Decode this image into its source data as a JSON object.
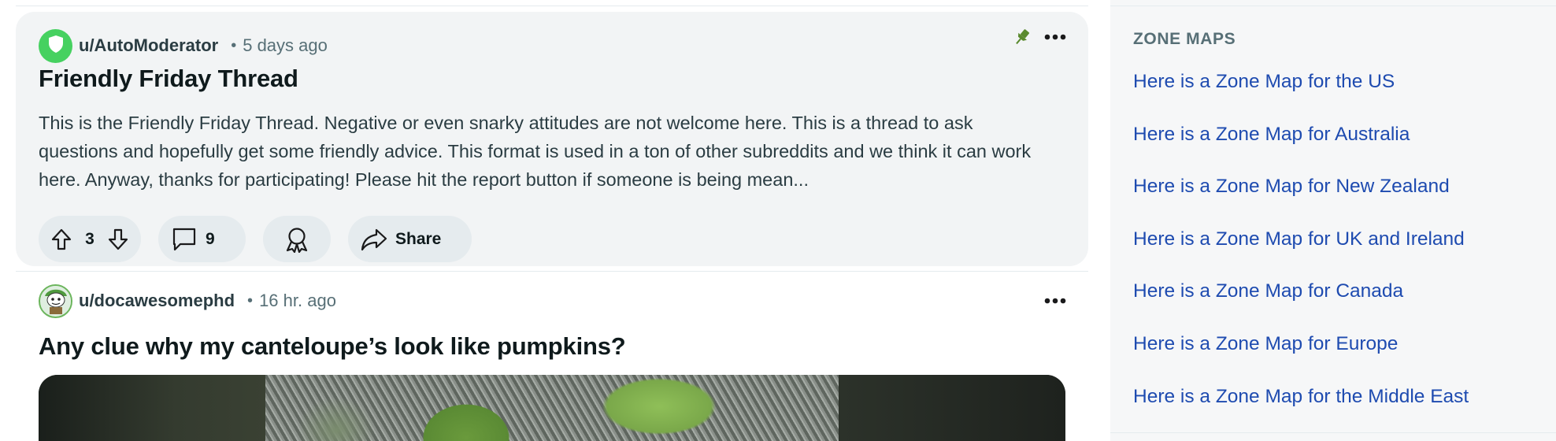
{
  "pinned_post": {
    "username": "u/AutoModerator",
    "separator": "•",
    "time_ago": "5 days ago",
    "title": "Friendly Friday Thread",
    "body": "This is the Friendly Friday Thread. Negative or even snarky attitudes are not welcome here. This is a thread to ask questions and hopefully get some friendly advice. This format is used in a ton of other subreddits and we think it can work here. Anyway, thanks for participating! Please hit the report button if someone is being mean...",
    "vote_count": "3",
    "comment_count": "9",
    "share_label": "Share",
    "pin_icon": "pin-icon",
    "more_icon": "more-options-icon",
    "avatar_icon": "shield-icon"
  },
  "second_post": {
    "username": "u/docawesomephd",
    "separator": "•",
    "time_ago": "16 hr. ago",
    "title": "Any clue why my canteloupe’s look like pumpkins?",
    "more_icon": "more-options-icon"
  },
  "sidebar": {
    "heading": "ZONE MAPS",
    "links": [
      "Here is a Zone Map for the US",
      "Here is a Zone Map for Australia",
      "Here is a Zone Map for New Zealand",
      "Here is a Zone Map for UK and Ireland",
      "Here is a Zone Map for Canada",
      "Here is a Zone Map for Europe",
      "Here is a Zone Map for the Middle East"
    ]
  },
  "colors": {
    "link": "#1e4bb0",
    "moderator_green": "#46d160",
    "pin_green": "#5a8a2e",
    "card_bg": "#f2f4f5",
    "pill_bg": "#e5ebee"
  }
}
